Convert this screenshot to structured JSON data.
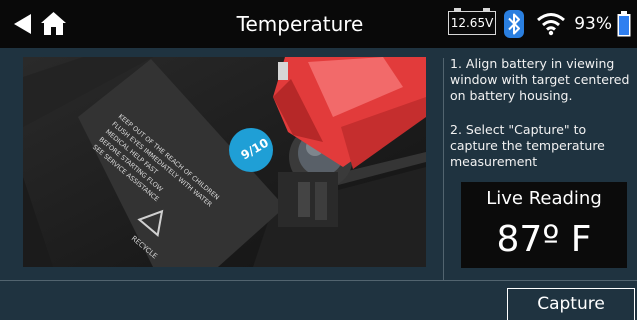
{
  "header": {
    "title": "Temperature",
    "voltage": "12.65V",
    "battery_percent": "93%",
    "icons": [
      "back-arrow-icon",
      "home-icon",
      "bluetooth-icon",
      "wifi-icon",
      "battery-icon"
    ]
  },
  "camera": {
    "sticker_text": "9/10",
    "label_text": "KEEP OUT OF THE REACH OF CHILDREN",
    "recycle_text": "RECYCLE"
  },
  "instructions": [
    "1. Align battery in viewing window with target centered on battery housing.",
    "2. Select \"Capture\" to capture the temperature measurement"
  ],
  "live_reading": {
    "label": "Live Reading",
    "value": "87º F"
  },
  "capture_button": {
    "label": "Capture"
  },
  "colors": {
    "background": "#1f3340",
    "topbar": "#090909",
    "clamp_red": "#e23b3b",
    "sticker_blue": "#1f9fd6",
    "bluetooth_blue": "#2a7fe0",
    "battery_blue": "#2f7ff0"
  }
}
